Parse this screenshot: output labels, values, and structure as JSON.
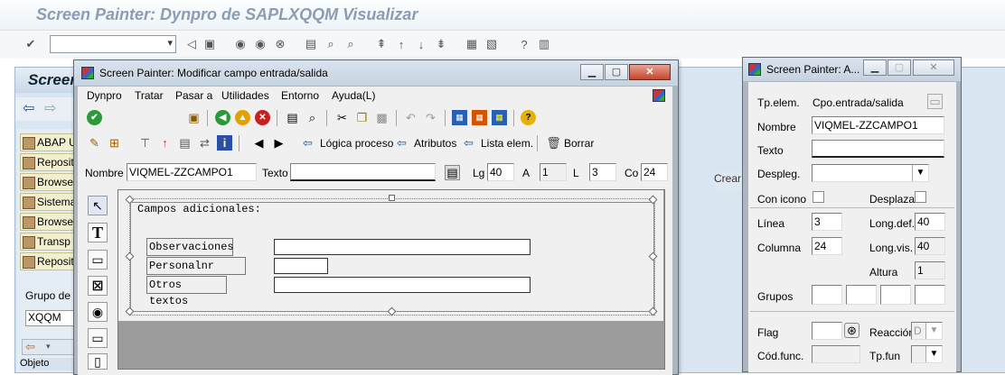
{
  "bg": {
    "title": "Screen Painter: Dynpro de SAPLXQQM Visualizar",
    "header": "Screen",
    "items": [
      "ABAP U",
      "Reposit",
      "Browse",
      "Sistema",
      "Browse",
      "Transp",
      "Reposit"
    ],
    "grupo_label": "Grupo de",
    "grupo_value": "XQQM",
    "objeto": "Objeto",
    "crea": "Crear"
  },
  "dlg": {
    "title": "Screen Painter:  Modificar campo entrada/salida",
    "menu": [
      "Dynpro",
      "Tratar",
      "Pasar a",
      "Utilidades",
      "Entorno",
      "Ayuda(L)"
    ],
    "tb2": {
      "logica": "Lógica proceso",
      "atributos": "Atributos",
      "lista": "Lista elem.",
      "borrar": "Borrar"
    },
    "attr": {
      "nombre_label": "Nombre",
      "nombre": "VIQMEL-ZZCAMPO1",
      "texto_label": "Texto",
      "texto": "",
      "lg_label": "Lg",
      "lg": "40",
      "a_label": "A",
      "a": "1",
      "l_label": "L",
      "l": "3",
      "co_label": "Co",
      "co": "24"
    },
    "screen": {
      "frame_title": "Campos adicionales:",
      "rows": [
        {
          "label": "Observaciones"
        },
        {
          "label": "Personalnr"
        },
        {
          "label": "Otros textos"
        }
      ]
    }
  },
  "rdlg": {
    "title": "Screen Painter: A...",
    "tp_label": "Tp.elem.",
    "tp": "Cpo.entrada/salida",
    "nombre_label": "Nombre",
    "nombre": "VIQMEL-ZZCAMPO1",
    "texto_label": "Texto",
    "despleg_label": "Despleg.",
    "conicono_label": "Con icono",
    "desplaz_label": "Desplazat",
    "linea_label": "Línea",
    "linea": "3",
    "longdef_label": "Long.def.",
    "longdef": "40",
    "columna_label": "Columna",
    "columna": "24",
    "longvis_label": "Long.vis.",
    "longvis": "40",
    "altura_label": "Altura",
    "altura": "1",
    "grupos_label": "Grupos",
    "flag_label": "Flag",
    "reaccion_label": "Reacción",
    "reaccion": "D",
    "codfunc_label": "Cód.func.",
    "tpfun_label": "Tp.fun"
  }
}
